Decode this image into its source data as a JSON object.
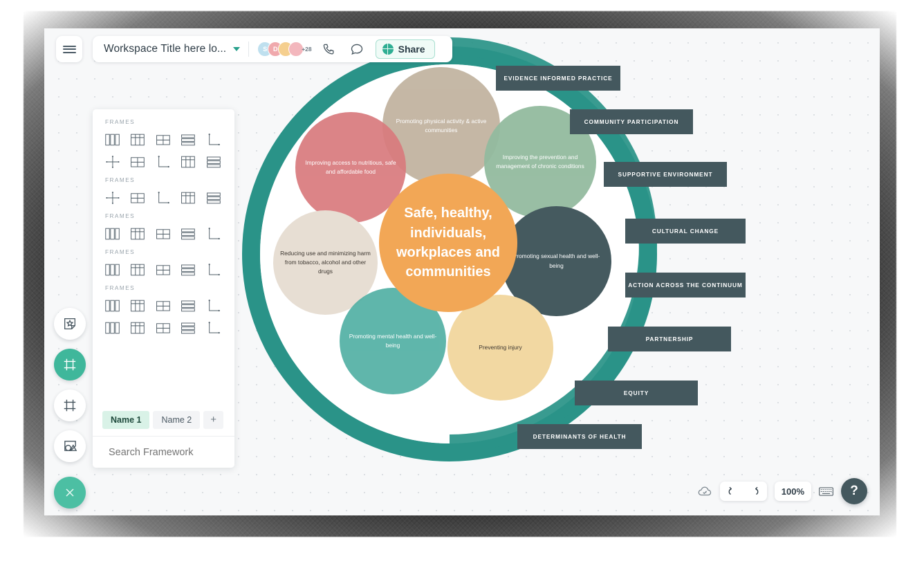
{
  "app": {
    "workspace_title": "Workspace Title here lo...",
    "share_label": "Share",
    "avatar_overflow": "+28",
    "avatars": [
      {
        "initial": "S",
        "color": "#bfe0ef"
      },
      {
        "initial": "D",
        "color": "#f0a9ad"
      },
      {
        "initial": "",
        "color": "#f5cf8f"
      },
      {
        "initial": "",
        "color": "#f3b7bd"
      }
    ],
    "icons": {
      "menu": "hamburger-icon",
      "caret": "chevron-down-icon",
      "call": "phone-icon",
      "chat": "comment-icon",
      "share": "globe-icon"
    }
  },
  "left_toolbar": {
    "items": [
      {
        "name": "sticker-tool",
        "icon": "sticker-star-icon",
        "active": false
      },
      {
        "name": "frame-tool",
        "icon": "frame-icon",
        "active": true
      },
      {
        "name": "grid-tool",
        "icon": "grid-frame-icon",
        "active": false
      },
      {
        "name": "shapes-tool",
        "icon": "shapes-icon",
        "active": false
      }
    ],
    "close_label": "×"
  },
  "frames_panel": {
    "groups": [
      {
        "title": "FRAMES",
        "rows": [
          [
            "columns",
            "grid3",
            "quad",
            "rows",
            "corner"
          ],
          [
            "crosshair",
            "quad",
            "corner",
            "grid3",
            "rows"
          ]
        ]
      },
      {
        "title": "FRAMES",
        "rows": [
          [
            "crosshair",
            "quad",
            "corner",
            "grid3",
            "rows"
          ]
        ]
      },
      {
        "title": "FRAMES",
        "rows": [
          [
            "columns",
            "grid3",
            "quad",
            "rows",
            "corner"
          ]
        ]
      },
      {
        "title": "FRAMES",
        "rows": [
          [
            "columns",
            "grid3",
            "quad",
            "rows",
            "corner"
          ]
        ]
      },
      {
        "title": "FRAMES",
        "rows": [
          [
            "columns",
            "grid3",
            "quad",
            "rows",
            "corner"
          ],
          [
            "columns",
            "grid3",
            "quad",
            "rows",
            "corner"
          ]
        ]
      }
    ],
    "tabs": [
      {
        "label": "Name 1",
        "selected": true
      },
      {
        "label": "Name 2",
        "selected": false
      }
    ],
    "add_tab_label": "+",
    "search_placeholder": "Search Framework",
    "more_icon": "kebab-menu-icon"
  },
  "diagram": {
    "ring_color": "#2a9388",
    "center": {
      "text": "Safe, healthy, individuals, workplaces and communities",
      "color": "#f2a756"
    },
    "bubbles": [
      {
        "id": "physical-activity",
        "text": "Promoting physical activity & active communities",
        "color": "#c3b5a2",
        "text_color": "#ffffff"
      },
      {
        "id": "nutrition",
        "text": "Improving access to nutritious, safe and affordable food",
        "color": "#d97b7e",
        "text_color": "#ffffff"
      },
      {
        "id": "chronic-conditions",
        "text": "Improving the prevention and management of chronic conditions",
        "color": "#93bb9f",
        "text_color": "#ffffff"
      },
      {
        "id": "substance-harm",
        "text": "Reducing use and minimizing harm from tobacco, alcohol and other drugs",
        "color": "#e7ded3",
        "text_color": "#3c3630"
      },
      {
        "id": "sexual-health",
        "text": "Promoting sexual health and well-being",
        "color": "#455a5f",
        "text_color": "#ffffff"
      },
      {
        "id": "mental-health",
        "text": "Promoting mental health and well-being",
        "color": "#52b0a4",
        "text_color": "#ffffff"
      },
      {
        "id": "injury",
        "text": "Preventing injury",
        "color": "#f2d8a2",
        "text_color": "#3c3630"
      }
    ],
    "tags": [
      {
        "label": "EVIDENCE   INFORMED   PRACTICE"
      },
      {
        "label": "COMMUNITY   PARTICIPATION"
      },
      {
        "label": "SUPPORTIVE   ENVIRONMENT"
      },
      {
        "label": "CULTURAL   CHANGE"
      },
      {
        "label": "ACTION   ACROSS   THE   CONTINUUM"
      },
      {
        "label": "PARTNERSHIP"
      },
      {
        "label": "EQUITY"
      },
      {
        "label": "DETERMINANTS   OF   HEALTH"
      }
    ],
    "tag_color": "#44585e"
  },
  "bottom_controls": {
    "cloud_icon": "cloud-saved-icon",
    "undo_icon": "undo-icon",
    "redo_icon": "redo-icon",
    "zoom_level": "100%",
    "keyboard_icon": "keyboard-icon",
    "help_label": "?"
  }
}
